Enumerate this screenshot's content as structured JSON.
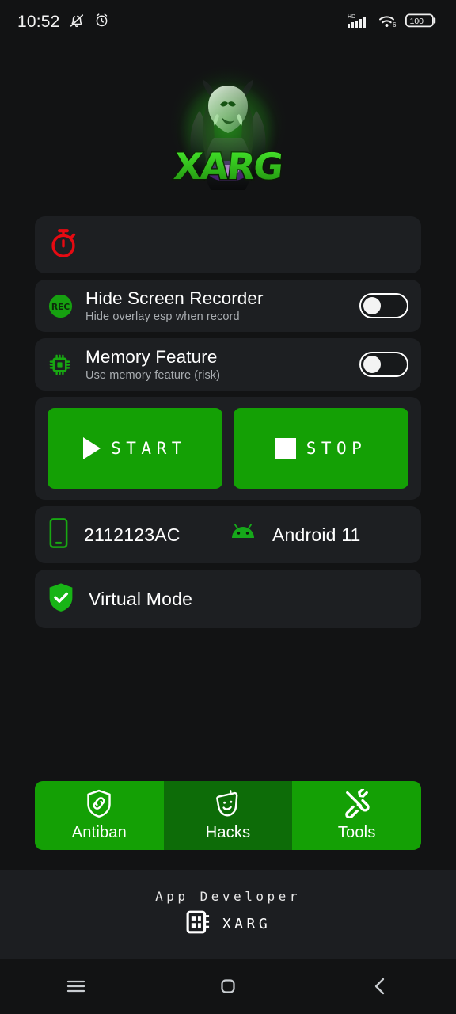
{
  "status_bar": {
    "time": "10:52",
    "left_icons": [
      "mute-bell-icon",
      "alarm-clock-icon"
    ],
    "network_label": "HD",
    "wifi_label": "6",
    "battery_level": "100"
  },
  "logo": {
    "alt": "xarg-logo",
    "wordmark": "XARG",
    "accent_color": "#2ed61e"
  },
  "timer_card": {
    "icon": "stopwatch-icon",
    "icon_color": "#e60a12",
    "value": ""
  },
  "toggles": [
    {
      "icon": "rec-icon",
      "icon_label": "REC",
      "title": "Hide Screen Recorder",
      "subtitle": "Hide overlay esp when record",
      "state": "off"
    },
    {
      "icon": "memory-chip-icon",
      "title": "Memory Feature",
      "subtitle": "Use memory feature (risk)",
      "state": "off"
    }
  ],
  "actions": {
    "start_label": "START",
    "start_icon": "play-icon",
    "stop_label": "STOP",
    "stop_icon": "stop-square-icon",
    "button_color": "#14a005"
  },
  "device": {
    "phone_icon": "smartphone-icon",
    "model": "2112123AC",
    "os_icon": "android-robot-icon",
    "os_version": "Android 11"
  },
  "virtual_mode": {
    "icon": "shield-check-icon",
    "label": "Virtual Mode"
  },
  "tabs": [
    {
      "label": "Antiban",
      "icon": "shield-link-icon",
      "selected": true
    },
    {
      "label": "Hacks",
      "icon": "theater-mask-icon",
      "selected": false
    },
    {
      "label": "Tools",
      "icon": "tools-wrench-icon",
      "selected": true
    }
  ],
  "footer": {
    "title": "App Developer",
    "icon": "developer-chip-icon",
    "name": "XARG"
  },
  "navigation_bar": {
    "recents": "recents-menu-icon",
    "home": "home-square-icon",
    "back": "back-chevron-icon"
  }
}
